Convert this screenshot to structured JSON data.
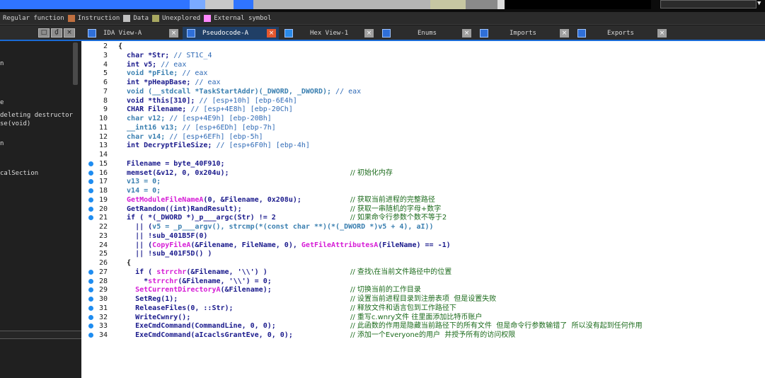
{
  "legend": [
    {
      "label": "Regular function",
      "color": "#ffffff",
      "show_swatch": false
    },
    {
      "label": "Instruction",
      "color": "#c07040",
      "show_swatch": true
    },
    {
      "label": "Data",
      "color": "#c0c0c0",
      "show_swatch": true
    },
    {
      "label": "Unexplored",
      "color": "#a8a860",
      "show_swatch": true
    },
    {
      "label": "External symbol",
      "color": "#ff88ff",
      "show_swatch": true
    }
  ],
  "window_buttons": [
    "□",
    "₫",
    "×"
  ],
  "tabs": [
    {
      "label": "IDA View-A",
      "active": false,
      "close": "×"
    },
    {
      "label": "Pseudocode-A",
      "active": true,
      "close": "×"
    },
    {
      "label": "Hex View-1",
      "active": false,
      "close": "×"
    },
    {
      "label": "Enums",
      "active": false,
      "close": "×"
    },
    {
      "label": "Imports",
      "active": false,
      "close": "×"
    },
    {
      "label": "Exports",
      "active": false,
      "close": "×"
    }
  ],
  "sidebar": {
    "items": [
      "n",
      "e",
      "deleting destructor",
      "se(void)",
      "n",
      "calSection"
    ]
  },
  "code_lines": [
    {
      "n": "2",
      "dot": false,
      "segs": [
        {
          "t": "{",
          "c": "tx"
        }
      ],
      "comment": ""
    },
    {
      "n": "3",
      "dot": false,
      "segs": [
        {
          "t": "  char *Str; ",
          "c": "kw"
        },
        {
          "t": "// ST1C_4",
          "c": "cm"
        }
      ],
      "comment": ""
    },
    {
      "n": "4",
      "dot": false,
      "segs": [
        {
          "t": "  int v5; ",
          "c": "kw"
        },
        {
          "t": "// eax",
          "c": "cm"
        }
      ],
      "comment": ""
    },
    {
      "n": "5",
      "dot": false,
      "segs": [
        {
          "t": "  void *pFile; ",
          "c": "var"
        },
        {
          "t": "// eax",
          "c": "cm"
        }
      ],
      "comment": ""
    },
    {
      "n": "6",
      "dot": false,
      "segs": [
        {
          "t": "  int *pHeapBase; ",
          "c": "kw"
        },
        {
          "t": "// eax",
          "c": "cm"
        }
      ],
      "comment": ""
    },
    {
      "n": "7",
      "dot": false,
      "segs": [
        {
          "t": "  void (__stdcall *TaskStartAddr)(_DWORD, _DWORD); ",
          "c": "var"
        },
        {
          "t": "// eax",
          "c": "cm"
        }
      ],
      "comment": ""
    },
    {
      "n": "8",
      "dot": false,
      "segs": [
        {
          "t": "  void *this[310]; ",
          "c": "kw"
        },
        {
          "t": "// [esp+10h] [ebp-6E4h]",
          "c": "cm"
        }
      ],
      "comment": ""
    },
    {
      "n": "9",
      "dot": false,
      "segs": [
        {
          "t": "  CHAR Filename; ",
          "c": "kw"
        },
        {
          "t": "// [esp+4E8h] [ebp-20Ch]",
          "c": "cm"
        }
      ],
      "comment": ""
    },
    {
      "n": "10",
      "dot": false,
      "segs": [
        {
          "t": "  char v12; ",
          "c": "var"
        },
        {
          "t": "// [esp+4E9h] [ebp-20Bh]",
          "c": "cm"
        }
      ],
      "comment": ""
    },
    {
      "n": "11",
      "dot": false,
      "segs": [
        {
          "t": "  __int16 v13; ",
          "c": "var"
        },
        {
          "t": "// [esp+6EDh] [ebp-7h]",
          "c": "cm"
        }
      ],
      "comment": ""
    },
    {
      "n": "12",
      "dot": false,
      "segs": [
        {
          "t": "  char v14; ",
          "c": "var"
        },
        {
          "t": "// [esp+6EFh] [ebp-5h]",
          "c": "cm"
        }
      ],
      "comment": ""
    },
    {
      "n": "13",
      "dot": false,
      "segs": [
        {
          "t": "  int DecryptFileSize; ",
          "c": "kw"
        },
        {
          "t": "// [esp+6F0h] [ebp-4h]",
          "c": "cm"
        }
      ],
      "comment": ""
    },
    {
      "n": "14",
      "dot": false,
      "segs": [],
      "comment": ""
    },
    {
      "n": "15",
      "dot": true,
      "segs": [
        {
          "t": "  Filename = byte_40F910;",
          "c": "kw"
        }
      ],
      "comment": ""
    },
    {
      "n": "16",
      "dot": true,
      "segs": [
        {
          "t": "  memset(&v12, 0, 0x204u);",
          "c": "kw"
        }
      ],
      "comment": "// 初始化内存"
    },
    {
      "n": "17",
      "dot": true,
      "segs": [
        {
          "t": "  v13 = 0;",
          "c": "var"
        }
      ],
      "comment": ""
    },
    {
      "n": "18",
      "dot": true,
      "segs": [
        {
          "t": "  v14 = 0;",
          "c": "var"
        }
      ],
      "comment": ""
    },
    {
      "n": "19",
      "dot": true,
      "segs": [
        {
          "t": "  GetModuleFileNameA",
          "c": "fn"
        },
        {
          "t": "(0, &Filename, 0x208u);",
          "c": "kw"
        }
      ],
      "comment": "// 获取当前进程的完整路径"
    },
    {
      "n": "20",
      "dot": true,
      "segs": [
        {
          "t": "  GetRandom((int)RandResult);",
          "c": "kw"
        }
      ],
      "comment": "// 获取一串随机的字母+数字"
    },
    {
      "n": "21",
      "dot": true,
      "segs": [
        {
          "t": "  if ( *(_DWORD *)_p___argc(Str) != 2",
          "c": "kw"
        }
      ],
      "comment": "// 如果命令行参数个数不等于2"
    },
    {
      "n": "22",
      "dot": false,
      "segs": [
        {
          "t": "    || (",
          "c": "kw"
        },
        {
          "t": "v5 = _p___argv(), strcmp(*(const char **)(*(_DWORD *)v5 + 4), aI))",
          "c": "var"
        }
      ],
      "comment": ""
    },
    {
      "n": "23",
      "dot": false,
      "segs": [
        {
          "t": "    || !sub_401B5F(0)",
          "c": "kw"
        }
      ],
      "comment": ""
    },
    {
      "n": "24",
      "dot": false,
      "segs": [
        {
          "t": "    || (",
          "c": "kw"
        },
        {
          "t": "CopyFileA",
          "c": "fn"
        },
        {
          "t": "(&Filename, FileName, 0), ",
          "c": "kw"
        },
        {
          "t": "GetFileAttributesA",
          "c": "fn"
        },
        {
          "t": "(FileName) == -1)",
          "c": "kw"
        }
      ],
      "comment": ""
    },
    {
      "n": "25",
      "dot": false,
      "segs": [
        {
          "t": "    || !sub_401F5D() )",
          "c": "kw"
        }
      ],
      "comment": ""
    },
    {
      "n": "26",
      "dot": false,
      "segs": [
        {
          "t": "  {",
          "c": "tx"
        }
      ],
      "comment": ""
    },
    {
      "n": "27",
      "dot": true,
      "segs": [
        {
          "t": "    if ( ",
          "c": "kw"
        },
        {
          "t": "strrchr",
          "c": "fn"
        },
        {
          "t": "(&Filename, '\\\\') )",
          "c": "kw"
        }
      ],
      "comment": "// 查找\\在当前文件路径中的位置"
    },
    {
      "n": "28",
      "dot": true,
      "segs": [
        {
          "t": "      *",
          "c": "kw"
        },
        {
          "t": "strrchr",
          "c": "fn"
        },
        {
          "t": "(&Filename, '\\\\') = 0;",
          "c": "kw"
        }
      ],
      "comment": ""
    },
    {
      "n": "29",
      "dot": true,
      "segs": [
        {
          "t": "    SetCurrentDirectoryA",
          "c": "fn"
        },
        {
          "t": "(&Filename);",
          "c": "kw"
        }
      ],
      "comment": "// 切换当前的工作目录"
    },
    {
      "n": "30",
      "dot": true,
      "segs": [
        {
          "t": "    SetReg(1);",
          "c": "kw"
        }
      ],
      "comment": "// 设置当前进程目录到注册表项  但是设置失败"
    },
    {
      "n": "31",
      "dot": true,
      "segs": [
        {
          "t": "    ReleaseFiles(0, ::Str);",
          "c": "kw"
        }
      ],
      "comment": "// 释放文件和语言包到工作路径下"
    },
    {
      "n": "32",
      "dot": true,
      "segs": [
        {
          "t": "    WriteCwnry();",
          "c": "kw"
        }
      ],
      "comment": "// 重写c.wnry文件 往里面添加比特币账户"
    },
    {
      "n": "33",
      "dot": true,
      "segs": [
        {
          "t": "    ExeCmdCommand(CommandLine, 0, 0);",
          "c": "kw"
        }
      ],
      "comment": "// 此函数的作用是隐藏当前路径下的所有文件  但是命令行参数输错了  所以没有起到任何作用"
    },
    {
      "n": "34",
      "dot": true,
      "segs": [
        {
          "t": "    ExeCmdCommand(aIcaclsGrantEve, 0, 0);",
          "c": "kw"
        }
      ],
      "comment": "// 添加一个Everyone的用户  并授予所有的访问权限"
    }
  ]
}
